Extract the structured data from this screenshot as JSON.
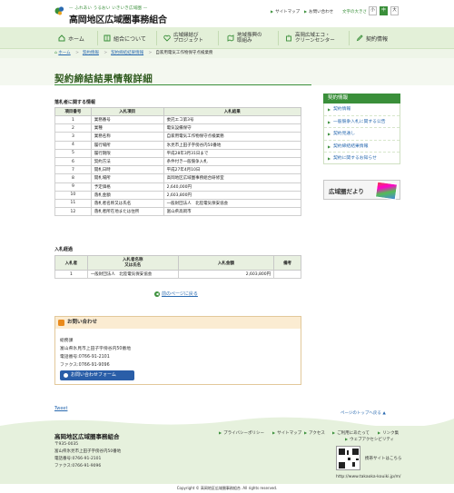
{
  "header": {
    "tagline": "— ふれあい うるおい いきいき広域圏 —",
    "org_name": "高岡地区広域圏事務組合",
    "sitemap": "サイトマップ",
    "contact": "お問い合わせ",
    "font_size_label": "文字の大きさ",
    "font_sizes": [
      "小",
      "中",
      "大"
    ]
  },
  "nav": [
    {
      "label": "ホーム",
      "icon": "home-icon"
    },
    {
      "label": "組合について",
      "icon": "book-icon"
    },
    {
      "label": "広域縁結び\nプロジェクト",
      "icon": "heart-icon"
    },
    {
      "label": "地域振興の\n取組み",
      "icon": "map-icon"
    },
    {
      "label": "高岡広域エコ・\nクリーンセンター",
      "icon": "building-icon"
    },
    {
      "label": "契約情報",
      "icon": "pen-icon"
    }
  ],
  "breadcrumb": [
    "ホーム",
    "契約情報",
    "契約締結結果情報",
    "自家用電気工作物保守点検業務"
  ],
  "page_title": "契約締結結果情報詳細",
  "winner_section": {
    "heading": "落札者に関する情報",
    "headers": [
      "項目番号",
      "入札項目",
      "入札結果"
    ],
    "rows": [
      [
        "1",
        "業務番号",
        "委託エコ第3号"
      ],
      [
        "2",
        "業種",
        "電気設備保守"
      ],
      [
        "3",
        "業務名称",
        "自家用電気工作物保守点検業務"
      ],
      [
        "4",
        "履行場所",
        "氷見市上田子字傍谷内50番地"
      ],
      [
        "5",
        "履行期限",
        "平成28年3月31日まで"
      ],
      [
        "6",
        "契約方法",
        "条件付き一般競争入札"
      ],
      [
        "7",
        "開札日時",
        "平成27年4月10日"
      ],
      [
        "8",
        "開札場所",
        "高岡地区広域圏事務組合研修室"
      ],
      [
        "9",
        "予定価格",
        "2,640,000円"
      ],
      [
        "10",
        "落札金額",
        "2,603,800円"
      ],
      [
        "11",
        "落札者名称又は氏名",
        "一般財団法人　北陸電気保安協会"
      ],
      [
        "12",
        "落札者所在地または住所",
        "富山県高岡市"
      ]
    ]
  },
  "bid_section": {
    "heading": "入札経過",
    "headers": [
      "入札者",
      "入札者名称\n又は氏名",
      "入札金額",
      "備考"
    ],
    "rows": [
      [
        "1",
        "一般財団法人　北陸電気保安協会",
        "2,603,800円",
        ""
      ]
    ]
  },
  "back_link": "前のページに戻る",
  "inquiry": {
    "heading": "お問い合わせ",
    "dept": "総務課",
    "address": "富山県氷見市上田子字傍谷内50番地",
    "tel": "電話番号:0766-91-2101",
    "fax": "ファクス:0766-91-9096",
    "button": "お問い合わせフォーム"
  },
  "tweet": "Tweet",
  "page_top": "ページのトップへ戻る",
  "sidebar": {
    "heading": "契約情報",
    "items": [
      "契約情報",
      "一般競争入札に関する公告",
      "契約見通し",
      "契約締結結果情報",
      "契約に関するお知らせ"
    ],
    "banner": "広域圏だより"
  },
  "footer": {
    "org": "高岡地区広域圏事務組合",
    "postal": "〒935-0035",
    "address": "富山県氷見市上田子字傍谷内50番地",
    "tel": "電話番号:0766-91-2101",
    "fax": "ファクス:0766-91-9096",
    "links": [
      "プライバシーポリシー",
      "サイトマップ",
      "アクセス",
      "ご利用にあたって",
      "リンク集",
      "ウェブアクセシビリティ"
    ],
    "mobile_label": "携帯サイトはこちら",
    "url": "http://www.takaoka-kouiki.jp/m/",
    "copyright": "Copyright © 高岡地区広域圏事務組合. All rights reserved."
  }
}
